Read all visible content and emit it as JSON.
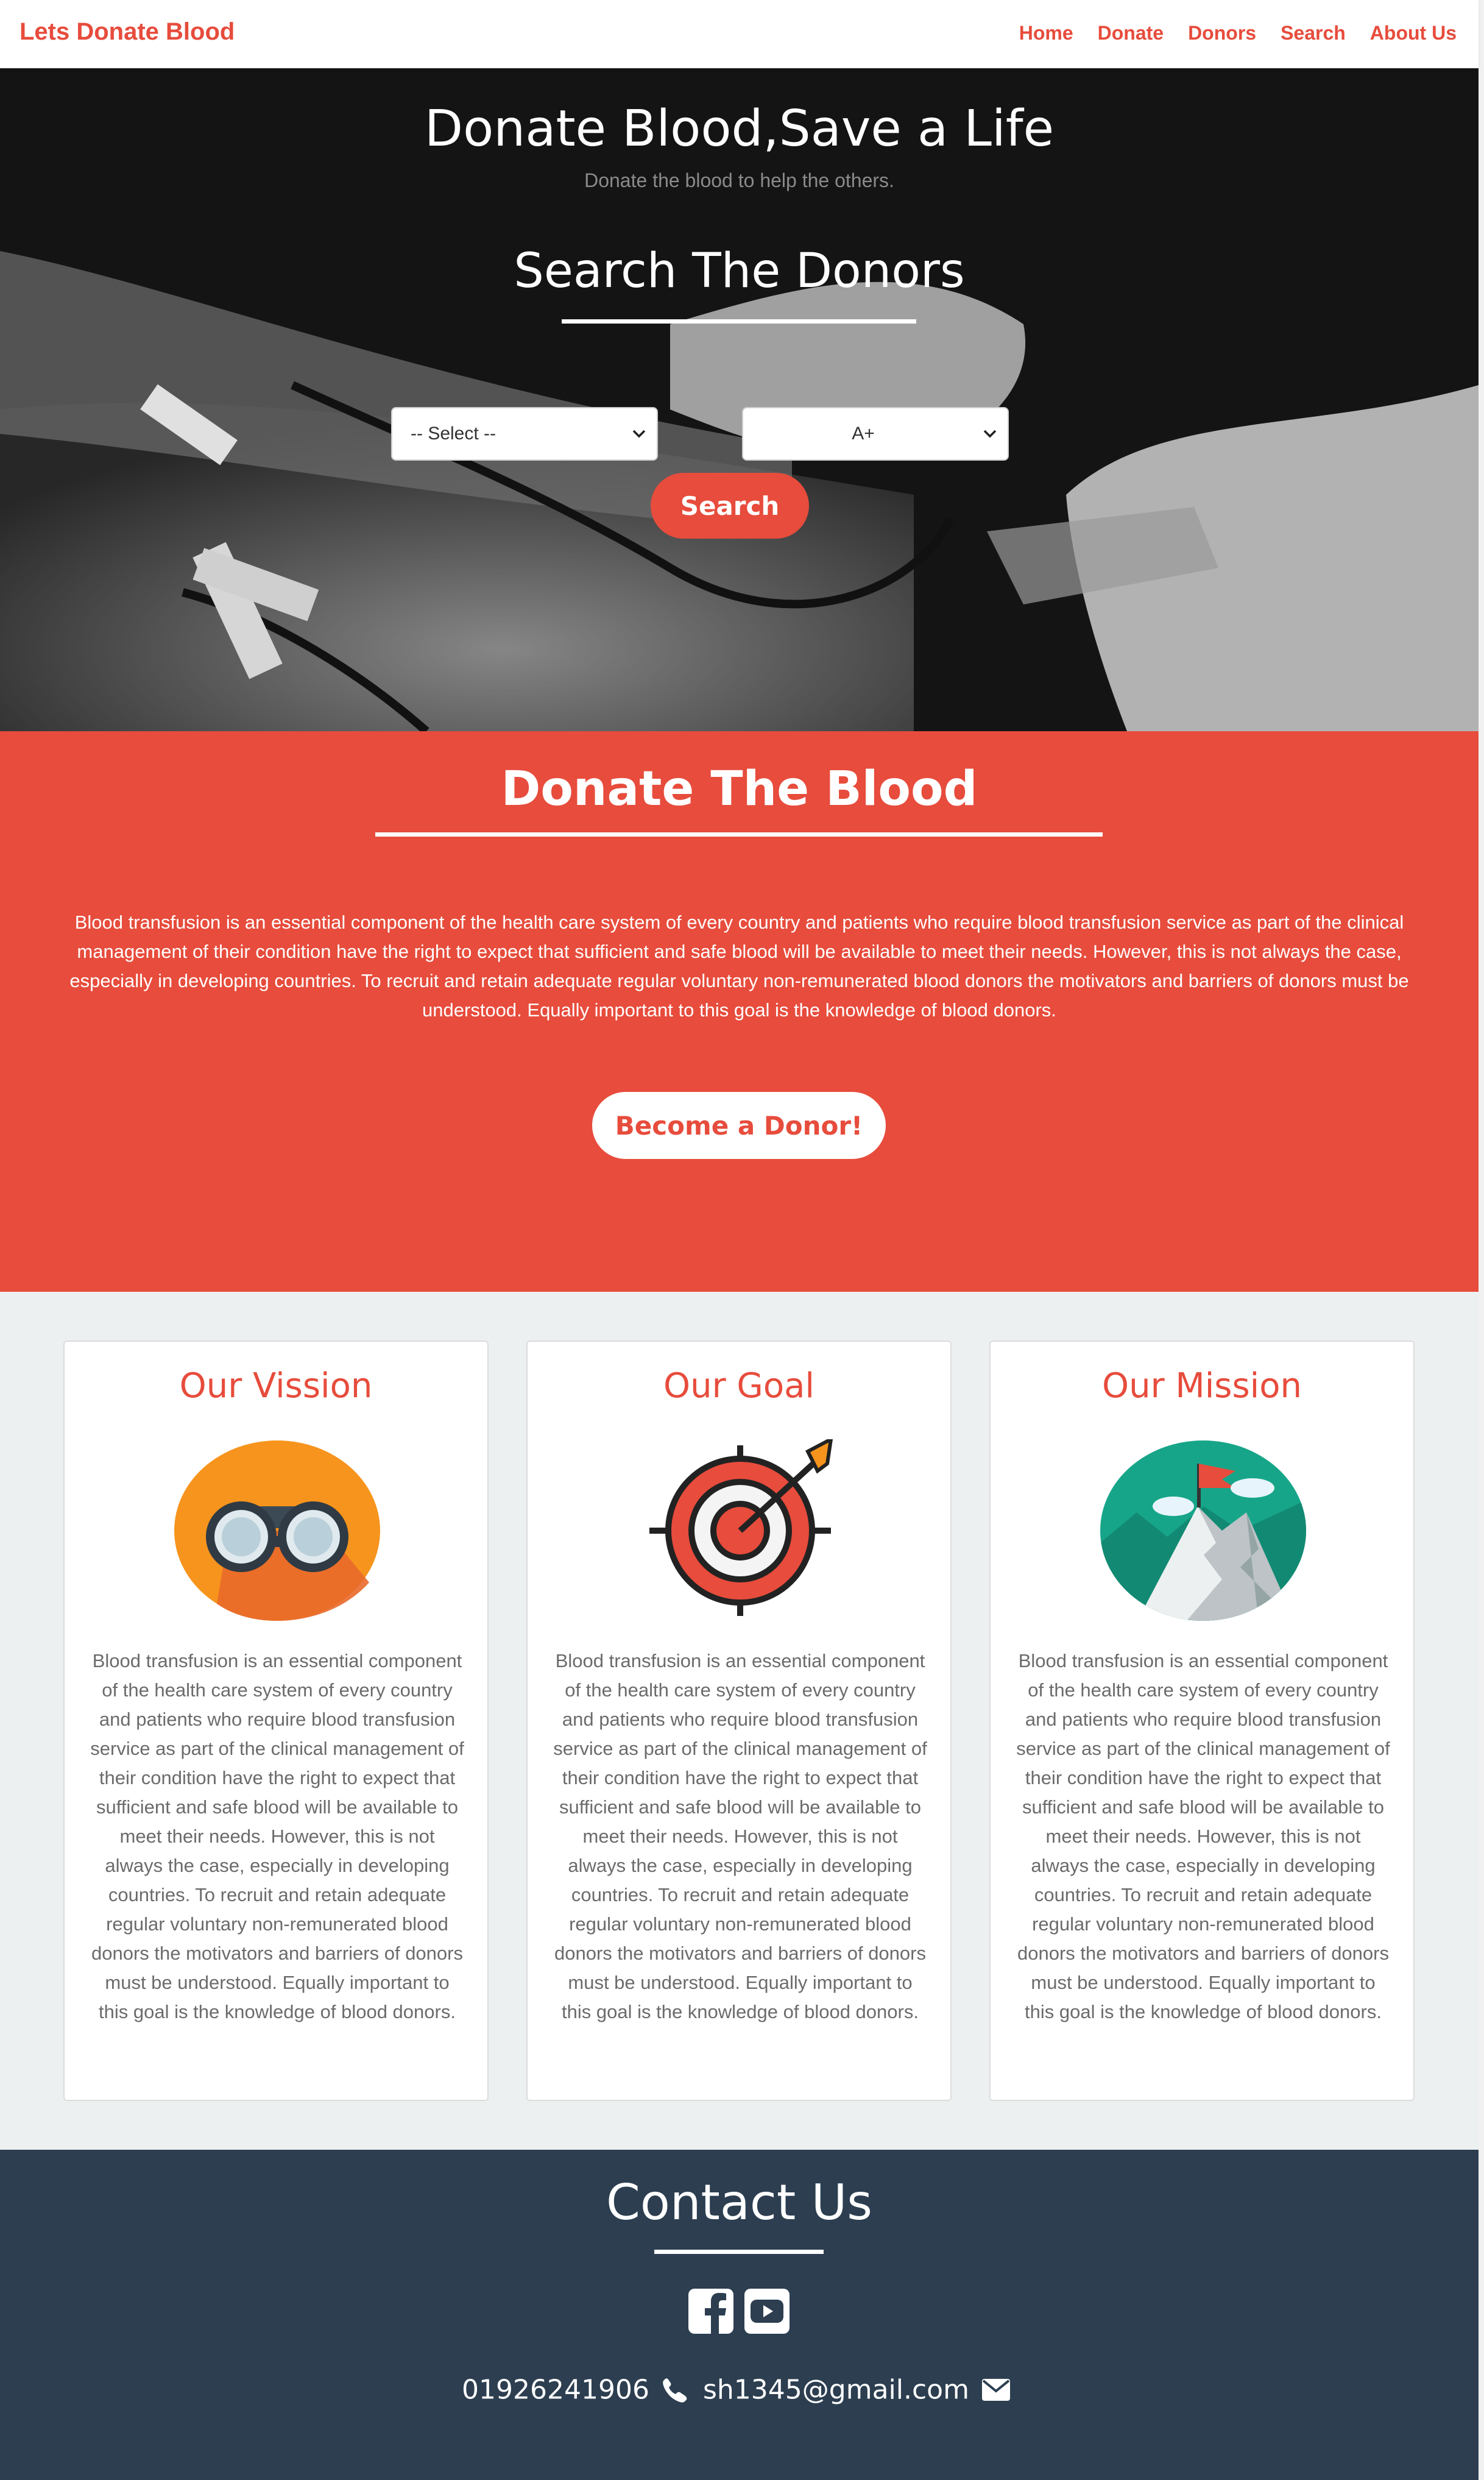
{
  "navbar": {
    "brand": "Lets Donate Blood",
    "links": [
      "Home",
      "Donate",
      "Donors",
      "Search",
      "About Us"
    ]
  },
  "hero": {
    "title": "Donate Blood,Save a Life",
    "subtitle": "Donate the blood to help the others.",
    "search_title": "Search The Donors",
    "select_location": "-- Select --",
    "select_blood_group": "A+",
    "search_button": "Search"
  },
  "donate": {
    "title": "Donate The Blood",
    "text": "Blood transfusion is an essential component of the health care system of every country and patients who require blood transfusion service as part of the clinical management of their condition have the right to expect that sufficient and safe blood will be available to meet their needs. However, this is not always the case, especially in developing countries. To recruit and retain adequate regular voluntary non-remunerated blood donors the motivators and barriers of donors must be understood. Equally important to this goal is the knowledge of blood donors.",
    "button": "Become a Donor!"
  },
  "cards": [
    {
      "title": "Our Vission",
      "icon": "binoculars-icon",
      "text": "Blood transfusion is an essential component of the health care system of every country and patients who require blood transfusion service as part of the clinical management of their condition have the right to expect that sufficient and safe blood will be available to meet their needs. However, this is not always the case, especially in developing countries. To recruit and retain adequate regular voluntary non-remunerated blood donors the motivators and barriers of donors must be understood. Equally important to this goal is the knowledge of blood donors."
    },
    {
      "title": "Our Goal",
      "icon": "target-icon",
      "text": "Blood transfusion is an essential component of the health care system of every country and patients who require blood transfusion service as part of the clinical management of their condition have the right to expect that sufficient and safe blood will be available to meet their needs. However, this is not always the case, especially in developing countries. To recruit and retain adequate regular voluntary non-remunerated blood donors the motivators and barriers of donors must be understood. Equally important to this goal is the knowledge of blood donors."
    },
    {
      "title": "Our Mission",
      "icon": "mountain-flag-icon",
      "text": "Blood transfusion is an essential component of the health care system of every country and patients who require blood transfusion service as part of the clinical management of their condition have the right to expect that sufficient and safe blood will be available to meet their needs. However, this is not always the case, especially in developing countries. To recruit and retain adequate regular voluntary non-remunerated blood donors the motivators and barriers of donors must be understood. Equally important to this goal is the knowledge of blood donors."
    }
  ],
  "contact": {
    "title": "Contact Us",
    "phone": "01926241906",
    "email": "sh1345@gmail.com",
    "social": [
      "facebook-icon",
      "youtube-icon"
    ]
  },
  "colors": {
    "accent": "#e74c3c",
    "footer": "#2c3e50",
    "section_bg": "#ecf0f1"
  }
}
